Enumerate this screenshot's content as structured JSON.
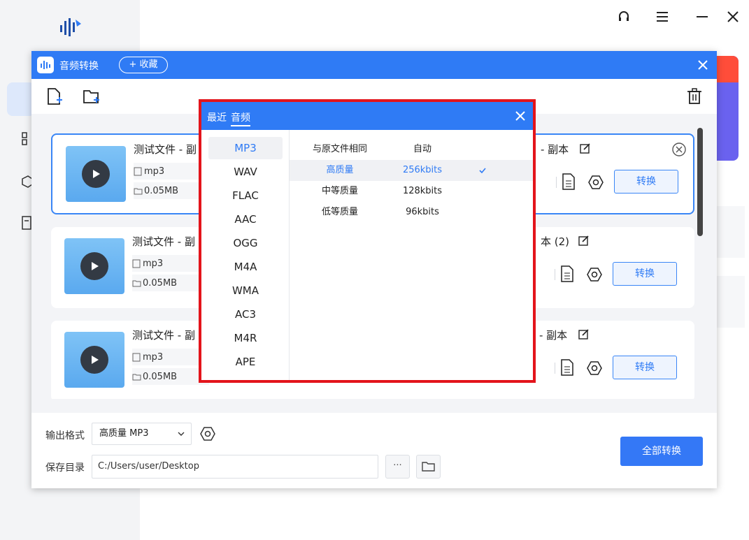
{
  "colors": {
    "accent": "#2f7bf5",
    "highlight_border": "#e3141b",
    "promo": "#6a62ef"
  },
  "dialog": {
    "title": "音频转换",
    "favorite_label": "+ 收藏"
  },
  "files": [
    {
      "name_left": "测试文件 - 副",
      "name_right": "- 副本",
      "format": "mp3",
      "size": "0.05MB",
      "action": "转换"
    },
    {
      "name_left": "测试文件 - 副",
      "name_right": "本 (2)",
      "format": "mp3",
      "size": "0.05MB",
      "action": "转换"
    },
    {
      "name_left": "测试文件 - 副",
      "name_right": "- 副本",
      "format": "mp3",
      "size": "0.05MB",
      "action": "转换"
    }
  ],
  "bottom": {
    "output_format_label": "输出格式",
    "output_format_value": "高质量 MP3",
    "save_dir_label": "保存目录",
    "save_dir_value": "C:/Users/user/Desktop",
    "more_label": "···",
    "convert_all_label": "全部转换"
  },
  "popup": {
    "tab_recent": "最近",
    "tab_audio": "音频",
    "formats": [
      "MP3",
      "WAV",
      "FLAC",
      "AAC",
      "OGG",
      "M4A",
      "WMA",
      "AC3",
      "M4R",
      "APE"
    ],
    "selected_format": "MP3",
    "qualities": [
      {
        "name": "与原文件相同",
        "rate": "自动"
      },
      {
        "name": "高质量",
        "rate": "256kbits"
      },
      {
        "name": "中等质量",
        "rate": "128kbits"
      },
      {
        "name": "低等质量",
        "rate": "96kbits"
      }
    ],
    "selected_quality": "高质量"
  }
}
